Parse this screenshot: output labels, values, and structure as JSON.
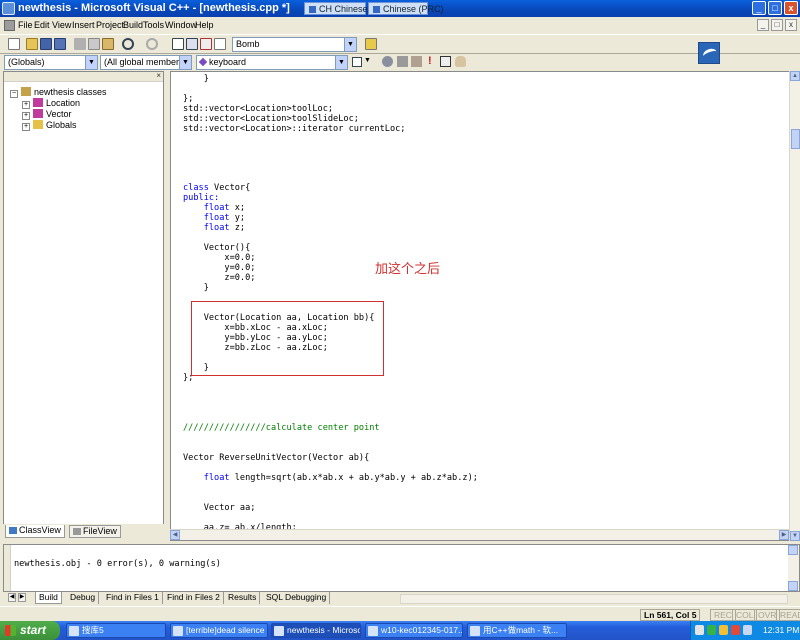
{
  "window": {
    "title": "newthesis - Microsoft Visual C++ - [newthesis.cpp *]",
    "ime_1": "CH Chinese (PRC)",
    "ime_2": "Chinese (PRC)",
    "min_label": "_",
    "max_label": "□",
    "close_label": "x"
  },
  "menu": {
    "items": [
      "File",
      "Edit",
      "View",
      "Insert",
      "Project",
      "Build",
      "Tools",
      "Window",
      "Help"
    ]
  },
  "toolbar": {
    "find_combo_value": "Bomb",
    "scope_combo_value": "(Globals)",
    "members_combo_value": "(All global members",
    "function_combo_value": "keyboard"
  },
  "classview": {
    "root": "newthesis classes",
    "items": [
      "Location",
      "Vector",
      "Globals"
    ],
    "tabs": [
      "ClassView",
      "FileView"
    ]
  },
  "editor": {
    "lines": [
      {
        "text": "    }",
        "kw": ""
      },
      {
        "text": "",
        "kw": ""
      },
      {
        "text": "};",
        "kw": ""
      },
      {
        "text": "std::vector<Location>toolLoc;",
        "kw": ""
      },
      {
        "text": "std::vector<Location>toolSlideLoc;",
        "kw": ""
      },
      {
        "text": "std::vector<Location>::iterator currentLoc;",
        "kw": ""
      },
      {
        "text": "class Vector{",
        "kw": "class"
      },
      {
        "text": "public:",
        "kw": "public:"
      },
      {
        "text": "    float x;",
        "kw": "float"
      },
      {
        "text": "    float y;",
        "kw": "float"
      },
      {
        "text": "    float z;",
        "kw": "float"
      },
      {
        "text": "    Vector(){",
        "kw": ""
      },
      {
        "text": "        x=0.0;",
        "kw": ""
      },
      {
        "text": "        y=0.0;",
        "kw": ""
      },
      {
        "text": "        z=0.0;",
        "kw": ""
      },
      {
        "text": "    }",
        "kw": ""
      },
      {
        "text": "    Vector(Location aa, Location bb){",
        "kw": ""
      },
      {
        "text": "        x=bb.xLoc - aa.xLoc;",
        "kw": ""
      },
      {
        "text": "        y=bb.yLoc - aa.yLoc;",
        "kw": ""
      },
      {
        "text": "        z=bb.zLoc - aa.zLoc;",
        "kw": ""
      },
      {
        "text": "    }",
        "kw": ""
      },
      {
        "text": "};",
        "kw": ""
      },
      {
        "text": "////////////////calculate center point",
        "kw": "comment"
      },
      {
        "text": "Vector ReverseUnitVector(Vector ab){",
        "kw": ""
      },
      {
        "text": "    float length=sqrt(ab.x*ab.x + ab.y*ab.y + ab.z*ab.z);",
        "kw": "float"
      },
      {
        "text": "    Vector aa;",
        "kw": ""
      },
      {
        "text": "    aa.z= ab.x/length;",
        "kw": ""
      }
    ],
    "annotation": "加这个之后"
  },
  "output": {
    "text": "newthesis.obj - 0 error(s), 0 warning(s)",
    "tabs": [
      "Build",
      "Debug",
      "Find in Files 1",
      "Find in Files 2",
      "Results",
      "SQL Debugging"
    ]
  },
  "status": {
    "position": "Ln 561, Col 5",
    "rec": "REC",
    "col": "COL",
    "ovr": "OVR",
    "read": "READ"
  },
  "taskbar": {
    "start": "start",
    "tasks": [
      "搜库5",
      "[terrible]dead silence",
      "newthesis - Microsoft...",
      "w10-kec012345-017....",
      "用C++做math - 软..."
    ],
    "clock": "12:31 PM"
  },
  "colors": {
    "keyword": "#0000ff",
    "comment": "#008000",
    "annotation": "#d03030",
    "titlebar": "#0a5fdc"
  }
}
